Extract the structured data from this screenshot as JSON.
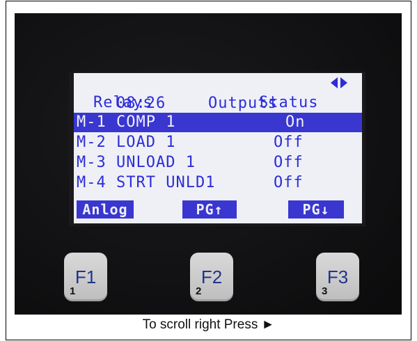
{
  "lcd": {
    "time": "08:26",
    "title": "Outputs",
    "nav_icon": "left-right-arrows-icon",
    "col_relays": "Relays",
    "col_status": "Status",
    "rows": [
      {
        "relay": "M-1 COMP 1",
        "status": "On",
        "selected": true
      },
      {
        "relay": "M-2 LOAD 1",
        "status": "Off",
        "selected": false
      },
      {
        "relay": "M-3 UNLOAD 1",
        "status": "Off",
        "selected": false
      },
      {
        "relay": "M-4 STRT UNLD1",
        "status": "Off",
        "selected": false
      }
    ],
    "softkeys": [
      "Anlog",
      "PG↑",
      "PG↓"
    ]
  },
  "keys": [
    {
      "label": "F1",
      "number": "1"
    },
    {
      "label": "F2",
      "number": "2"
    },
    {
      "label": "F3",
      "number": "3"
    }
  ],
  "caption": "To scroll right Press ►",
  "colors": {
    "lcd_background": "#eef0f6",
    "lcd_text": "#2d2dd8",
    "highlight": "#3a36d0",
    "device_body": "#121214",
    "key_face": "#cfcfcf"
  }
}
